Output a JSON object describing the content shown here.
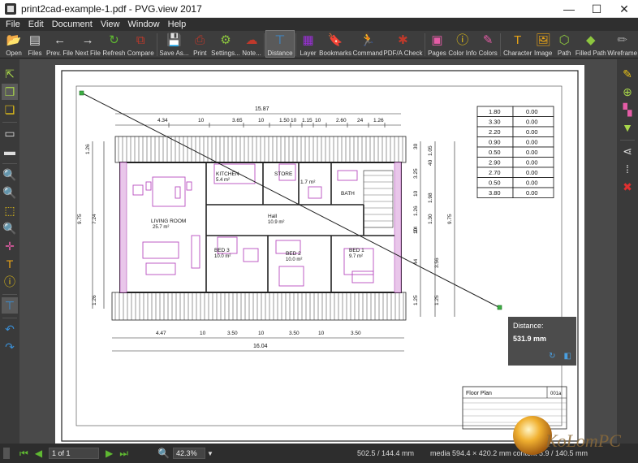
{
  "window": {
    "title": "print2cad-example-1.pdf - PVG.view 2017",
    "minimize": "—",
    "maximize": "☐",
    "close": "✕"
  },
  "menu": [
    "File",
    "Edit",
    "Document",
    "View",
    "Window",
    "Help"
  ],
  "toolbar": [
    {
      "label": "Open",
      "icon": "open-folder-icon",
      "glyph": "📂",
      "color": "#e8a317"
    },
    {
      "label": "Files",
      "icon": "files-stack-icon",
      "glyph": "▤",
      "color": "#ddd"
    },
    {
      "label": "Prev. File",
      "icon": "arrow-left-icon",
      "glyph": "←",
      "color": "#ddd"
    },
    {
      "label": "Next File",
      "icon": "arrow-right-icon",
      "glyph": "→",
      "color": "#ddd"
    },
    {
      "label": "Refresh",
      "icon": "refresh-icon",
      "glyph": "↻",
      "color": "#5fb832"
    },
    {
      "label": "Compare",
      "icon": "compare-icon",
      "glyph": "⧉",
      "color": "#c0392b"
    },
    {
      "label": "Save As...",
      "icon": "save-icon",
      "glyph": "💾",
      "color": "#3a8fd6"
    },
    {
      "label": "Print",
      "icon": "print-icon",
      "glyph": "⎙",
      "color": "#c0392b"
    },
    {
      "label": "Settings...",
      "icon": "gear-icon",
      "glyph": "⚙",
      "color": "#8dc63f"
    },
    {
      "label": "Note...",
      "icon": "note-cloud-icon",
      "glyph": "☁",
      "color": "#c0392b"
    },
    {
      "label": "Distance",
      "icon": "distance-ruler-icon",
      "glyph": "⊤",
      "color": "#3a8fd6"
    },
    {
      "label": "Layer",
      "icon": "layer-icon",
      "glyph": "▦",
      "color": "#9b30d9"
    },
    {
      "label": "Bookmarks",
      "icon": "bookmark-icon",
      "glyph": "🔖",
      "color": "#999"
    },
    {
      "label": "Command",
      "icon": "command-runner-icon",
      "glyph": "🏃",
      "color": "#3a8fd6"
    },
    {
      "label": "PDF/A Check",
      "icon": "pdfa-check-icon",
      "glyph": "✱",
      "color": "#c0392b"
    },
    {
      "label": "Pages",
      "icon": "pages-icon",
      "glyph": "▣",
      "color": "#e55ca6"
    },
    {
      "label": "Color Info",
      "icon": "info-icon",
      "glyph": "ⓘ",
      "color": "#e8c317"
    },
    {
      "label": "Colors",
      "icon": "colors-pencil-icon",
      "glyph": "✎",
      "color": "#e55ca6"
    },
    {
      "label": "Character",
      "icon": "character-t-icon",
      "glyph": "T",
      "color": "#e8a317"
    },
    {
      "label": "Image",
      "icon": "image-icon",
      "glyph": "🖼",
      "color": "#e8a317"
    },
    {
      "label": "Path",
      "icon": "path-icon",
      "glyph": "⬡",
      "color": "#8dc63f"
    },
    {
      "label": "Filled Path",
      "icon": "filled-path-icon",
      "glyph": "◆",
      "color": "#8dc63f"
    },
    {
      "label": "Wireframe",
      "icon": "wireframe-icon",
      "glyph": "✏",
      "color": "#999"
    }
  ],
  "left_tools": [
    {
      "name": "export-icon",
      "glyph": "⇱",
      "color": "#a8d64a"
    },
    {
      "name": "page-copy-icon",
      "glyph": "❐",
      "color": "#a8d64a",
      "active": true
    },
    {
      "name": "pages-icon",
      "glyph": "❏",
      "color": "#e8c317"
    },
    {
      "name": "fit-page-icon",
      "glyph": "▭",
      "color": "#ddd"
    },
    {
      "name": "fit-width-icon",
      "glyph": "▬",
      "color": "#ddd"
    },
    {
      "name": "zoom-in-icon",
      "glyph": "🔍",
      "color": "#3a8fd6"
    },
    {
      "name": "zoom-out-icon",
      "glyph": "🔍",
      "color": "#3a8fd6"
    },
    {
      "name": "zoom-window-icon",
      "glyph": "⬚",
      "color": "#e8c317"
    },
    {
      "name": "zoom-icon",
      "glyph": "🔍",
      "color": "#e8c317"
    },
    {
      "name": "pan-icon",
      "glyph": "✛",
      "color": "#e55ca6"
    },
    {
      "name": "text-select-icon",
      "glyph": "T",
      "color": "#e8a317"
    },
    {
      "name": "info-icon",
      "glyph": "ⓘ",
      "color": "#e8c317"
    },
    {
      "name": "distance-icon",
      "glyph": "⊤",
      "color": "#3a8fd6",
      "active": true
    },
    {
      "name": "undo-icon",
      "glyph": "↶",
      "color": "#3a8fd6"
    },
    {
      "name": "redo-icon",
      "glyph": "↷",
      "color": "#3a8fd6"
    }
  ],
  "right_tools": [
    {
      "name": "pencil-icon",
      "glyph": "✎",
      "color": "#e8c317"
    },
    {
      "name": "snap-point-icon",
      "glyph": "⊕",
      "color": "#a8d64a"
    },
    {
      "name": "checker-icon",
      "glyph": "▚",
      "color": "#e55ca6"
    },
    {
      "name": "triangle-down-icon",
      "glyph": "▼",
      "color": "#a8d64a"
    },
    {
      "name": "share-icon",
      "glyph": "⋖",
      "color": "#ddd"
    },
    {
      "name": "grid-dots-icon",
      "glyph": "⁞",
      "color": "#ddd"
    },
    {
      "name": "close-x-icon",
      "glyph": "✖",
      "color": "#e03030"
    }
  ],
  "drawing": {
    "dims_top_total": "15.87",
    "dims_top": [
      "4.34",
      "10",
      "3.65",
      "10",
      "1.50",
      "10",
      "1.15",
      "10",
      "2.60",
      "24",
      "1.26"
    ],
    "dims_bottom": [
      "4.47",
      "10",
      "3.50",
      "10",
      "3.50",
      "10",
      "3.50"
    ],
    "dims_bottom_total": "16.04",
    "dims_left": [
      "1.26",
      "9.75",
      "7.24",
      "1.26"
    ],
    "dims_right_a": [
      "30",
      "1.05",
      "3.25",
      "10",
      "1.98",
      "1.30",
      "10",
      "40",
      "1.26",
      "24",
      "44",
      "1.25"
    ],
    "dims_right_b": [
      "9.75",
      "3.56",
      "1.25"
    ],
    "rooms": [
      {
        "name": "KITCHEN",
        "area": "5.4 m²"
      },
      {
        "name": "STORE",
        "area": ""
      },
      {
        "name": "1.7 m²",
        "area": ""
      },
      {
        "name": "BATH",
        "area": ""
      },
      {
        "name": "LIVING ROOM",
        "area": "25.7 m²"
      },
      {
        "name": "Hall",
        "area": "10.9 m²"
      },
      {
        "name": "BED 3",
        "area": "10.0 m²"
      },
      {
        "name": "BED 2",
        "area": "10.0 m²"
      },
      {
        "name": "BED 1",
        "area": "9.7 m²"
      }
    ],
    "table": [
      [
        "1.80",
        "0.00"
      ],
      [
        "3.30",
        "0.00"
      ],
      [
        "2.20",
        "0.00"
      ],
      [
        "0.90",
        "0.00"
      ],
      [
        "0.50",
        "0.00"
      ],
      [
        "2.90",
        "0.00"
      ],
      [
        "2.70",
        "0.00"
      ],
      [
        "0.50",
        "0.00"
      ],
      [
        "3.80",
        "0.00"
      ]
    ],
    "titleblock": {
      "label": "Floor Plan",
      "code": "001a"
    }
  },
  "distance": {
    "title": "Distance:",
    "value": "531.9 mm"
  },
  "status": {
    "page": "1 of 1",
    "zoom": "42.3%",
    "coords": "502.5 / 144.4 mm",
    "media": "media 594.4 × 420.2 mm",
    "content": "content",
    "content_val": "5.9 / 140.5 mm"
  },
  "watermark": {
    "text": "KoLomPC"
  }
}
